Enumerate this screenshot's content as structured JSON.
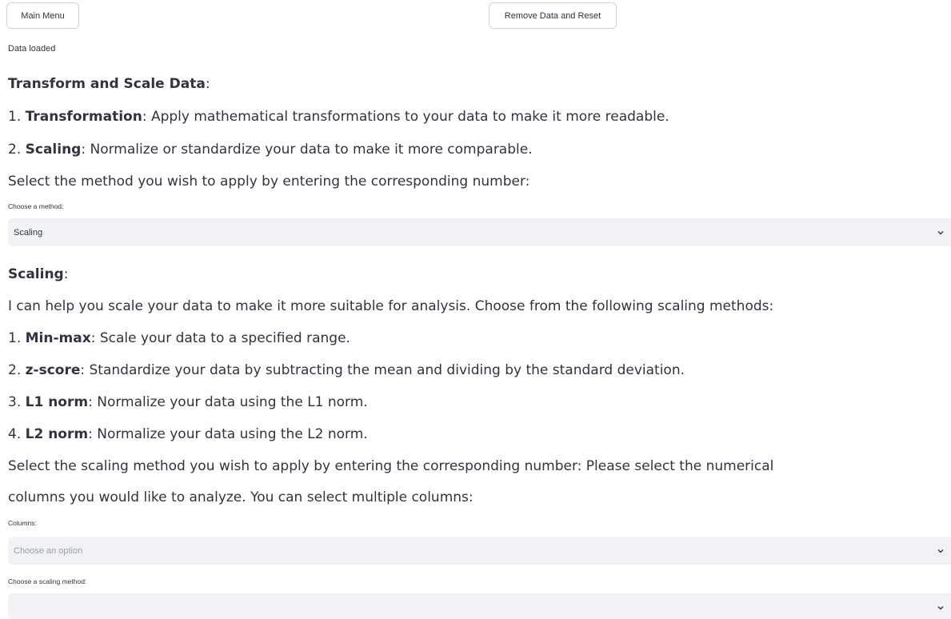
{
  "toolbar": {
    "main_menu_label": "Main Menu",
    "reset_label": "Remove Data and Reset"
  },
  "status": {
    "text": "Data loaded"
  },
  "transform_section": {
    "heading_bold": "Transform and Scale Data",
    "heading_suffix": ":",
    "items": [
      {
        "num": "1. ",
        "bold": "Transformation",
        "rest": ": Apply mathematical transformations to your data to make it more readable."
      },
      {
        "num": "2. ",
        "bold": "Scaling",
        "rest": ": Normalize or standardize your data to make it more comparable."
      }
    ],
    "instruction": "Select the method you wish to apply by entering the corresponding number:",
    "method_select": {
      "label": "Choose a method:",
      "value": "Scaling"
    }
  },
  "scaling_section": {
    "heading_bold": "Scaling",
    "heading_suffix": ":",
    "intro": "I can help you scale your data to make it more suitable for analysis. Choose from the following scaling methods:",
    "items": [
      {
        "num": "1. ",
        "bold": "Min-max",
        "rest": ": Scale your data to a specified range."
      },
      {
        "num": "2. ",
        "bold": "z-score",
        "rest": ": Standardize your data by subtracting the mean and dividing by the standard deviation."
      },
      {
        "num": "3. ",
        "bold": "L1 norm",
        "rest": ": Normalize your data using the L1 norm."
      },
      {
        "num": "4. ",
        "bold": "L2 norm",
        "rest": ": Normalize your data using the L2 norm."
      }
    ],
    "instruction_line1": "Select the scaling method you wish to apply by entering the corresponding number: Please select the numerical",
    "instruction_line2": "columns you would like to analyze. You can select multiple columns:",
    "columns_select": {
      "label": "Columns:",
      "placeholder": "Choose an option"
    },
    "scaling_select": {
      "label": "Choose a scaling method:",
      "value": ""
    }
  },
  "icons": {
    "select_arrow": "chevron-down-icon"
  }
}
